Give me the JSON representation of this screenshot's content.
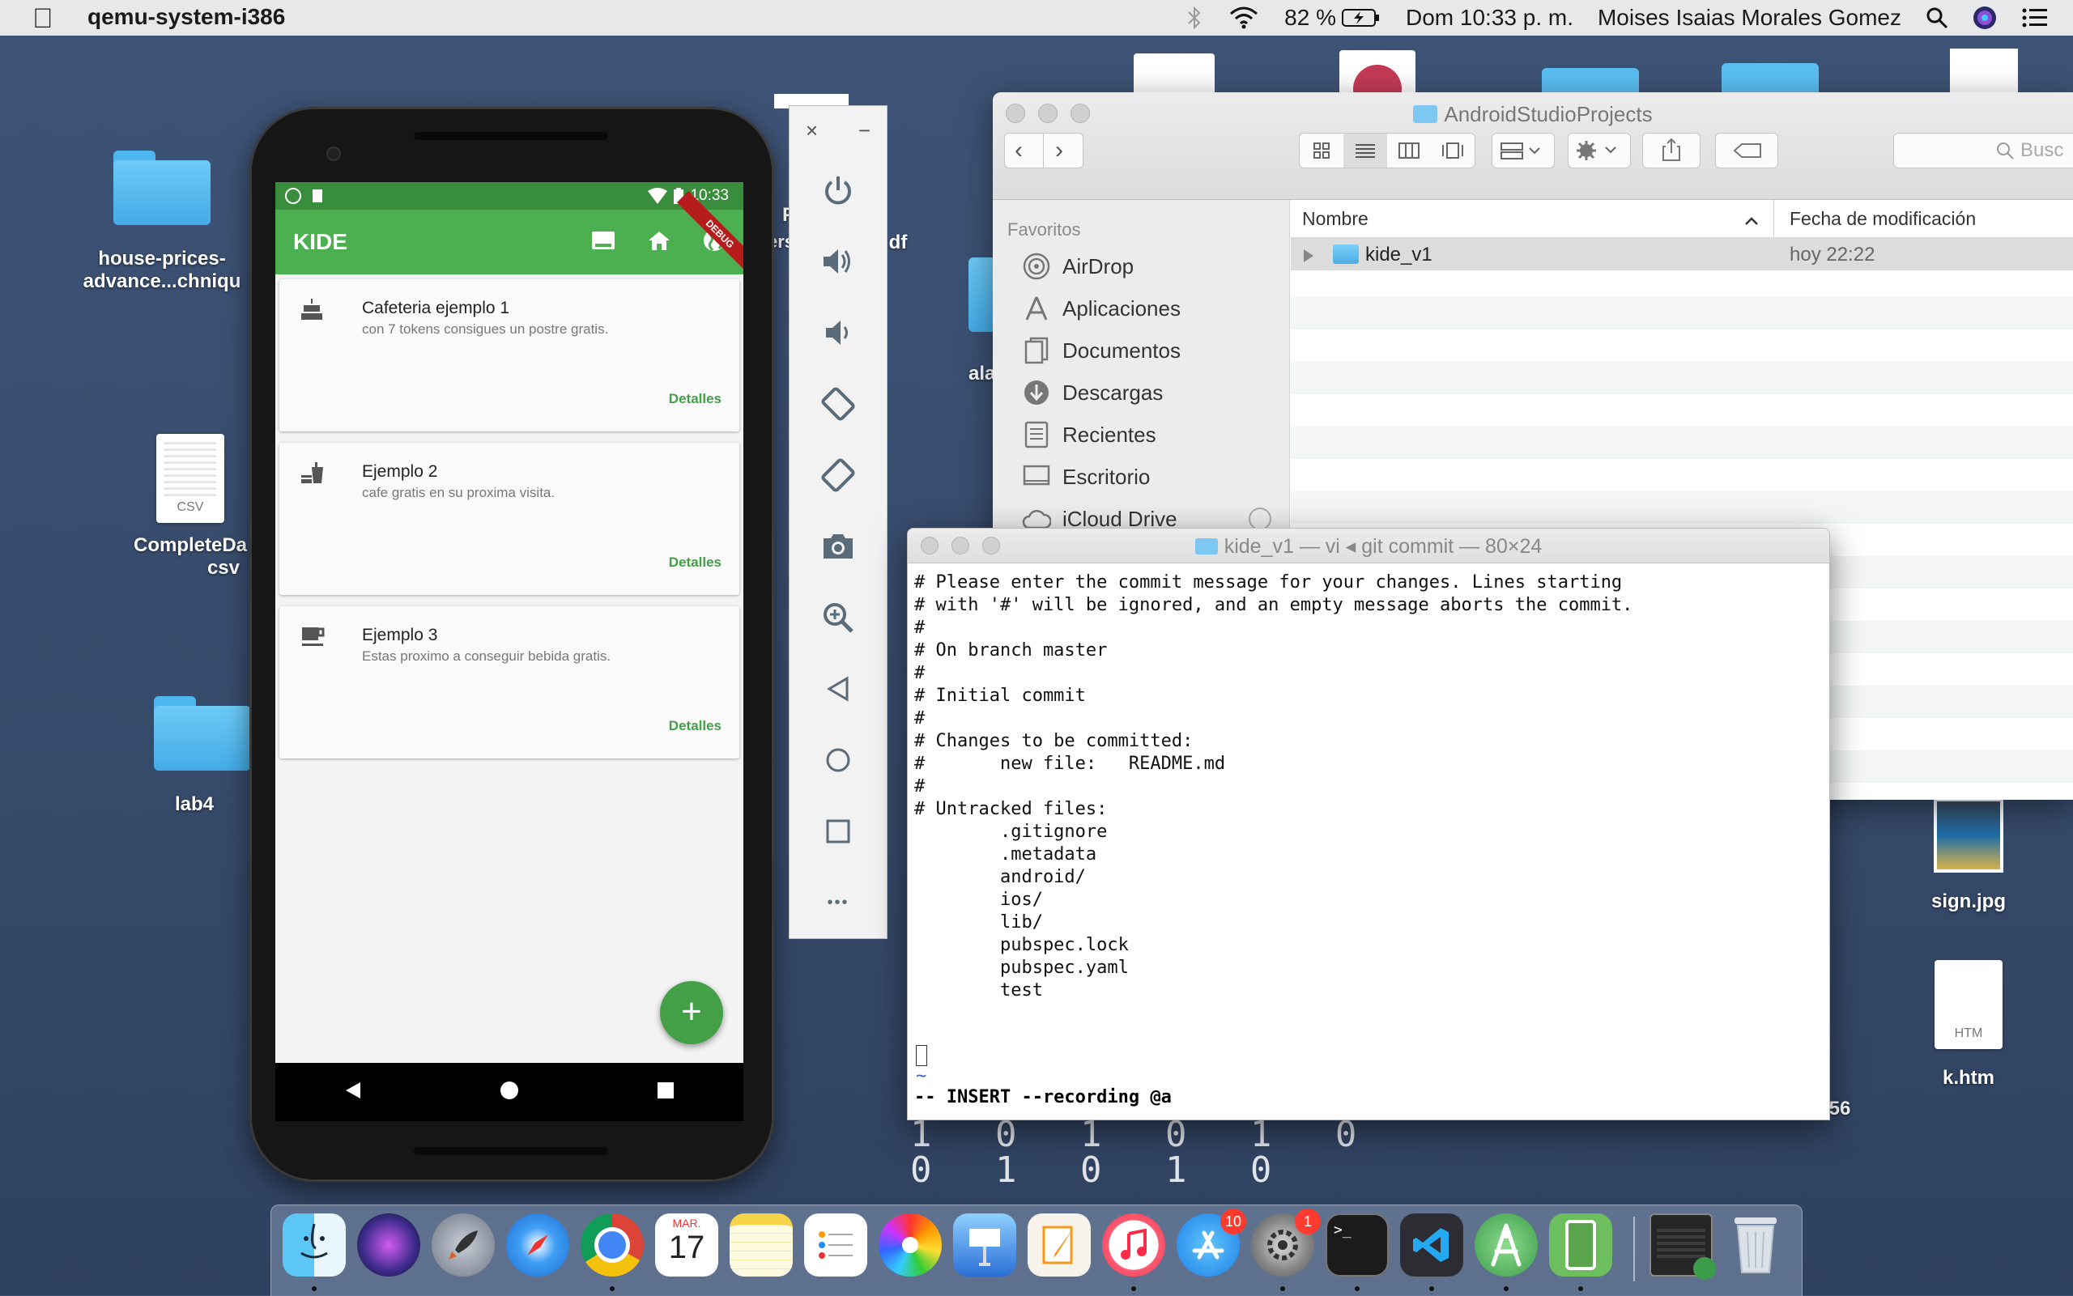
{
  "menubar": {
    "app_name": "qemu-system-i386",
    "battery": "82 %",
    "clock": "Dom 10:33 p. m.",
    "user": "Moises Isaias Morales Gomez"
  },
  "desktop": {
    "icons": [
      {
        "label_line1": "house-prices-",
        "label_line2": "advance...chniqu"
      },
      {
        "label_line1": "CompleteDa",
        "label_line2": "csv",
        "ext": "CSV"
      },
      {
        "label_line1": "lab4"
      },
      {
        "label_line1": "ala"
      },
      {
        "label_line1": "sign.jpg"
      },
      {
        "label_line1": "k.htm",
        "ext": "HTM"
      },
      {
        "label_line1": "56"
      },
      {
        "label_line1": "P"
      },
      {
        "label_line1": "ers"
      },
      {
        "label_line1": "df"
      }
    ],
    "binary_rows": [
      "1 0 1 0 1 0",
      "0 1 0 1 0"
    ]
  },
  "phone": {
    "status_time": "10:33",
    "debug_label": "DEBUG",
    "app_title": "KIDE",
    "cards": [
      {
        "title": "Cafeteria ejemplo 1",
        "subtitle": "con 7 tokens consigues un postre gratis.",
        "action": "Detalles"
      },
      {
        "title": "Ejemplo 2",
        "subtitle": "cafe gratis en su proxima visita.",
        "action": "Detalles"
      },
      {
        "title": "Ejemplo 3",
        "subtitle": "Estas proximo a conseguir bebida gratis.",
        "action": "Detalles"
      }
    ],
    "fab_label": "+"
  },
  "emulator": {
    "close": "×",
    "minimize": "−",
    "more": "•••"
  },
  "finder": {
    "title": "AndroidStudioProjects",
    "search_placeholder": "Busc",
    "sidebar_header": "Favoritos",
    "sidebar_items": [
      "AirDrop",
      "Aplicaciones",
      "Documentos",
      "Descargas",
      "Recientes",
      "Escritorio",
      "iCloud Drive"
    ],
    "columns": {
      "name": "Nombre",
      "modified": "Fecha de modificación"
    },
    "rows": [
      {
        "name": "kide_v1",
        "modified": "hoy 22:22"
      }
    ]
  },
  "terminal": {
    "title": "kide_v1 — vi ◂ git commit — 80×24",
    "lines": [
      "# Please enter the commit message for your changes. Lines starting",
      "# with '#' will be ignored, and an empty message aborts the commit.",
      "#",
      "# On branch master",
      "#",
      "# Initial commit",
      "#",
      "# Changes to be committed:",
      "#       new file:   README.md",
      "#",
      "# Untracked files:",
      "        .gitignore",
      "        .metadata",
      "        android/",
      "        ios/",
      "        lib/",
      "        pubspec.lock",
      "        pubspec.yaml",
      "        test"
    ],
    "tilde": "~",
    "mode_line": "-- INSERT --recording @a"
  },
  "dock": {
    "calendar_month": "MAR.",
    "calendar_day": "17",
    "appstore_badge": "10",
    "prefs_badge": "1",
    "terminal_glyph": ">_"
  }
}
